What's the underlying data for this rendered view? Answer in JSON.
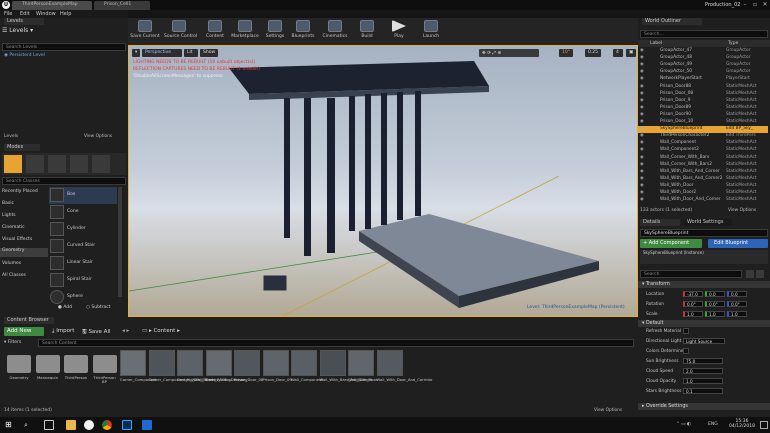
{
  "window": {
    "tabs": [
      "ThirdPersonExampleMap",
      "Prison_Cell1"
    ],
    "project_name": "Production_02",
    "logo": "U"
  },
  "menu": [
    "File",
    "Edit",
    "Window",
    "Help"
  ],
  "levels_panel": {
    "tab": "Levels",
    "title": "Levels",
    "search_placeholder": "Search Levels",
    "item": "Persistent Level",
    "footer": "Levels",
    "view_options": "View Options"
  },
  "modes_panel": {
    "tab": "Modes",
    "search_placeholder": "Search Classes",
    "categories": [
      "Recently Placed",
      "Basic",
      "Lights",
      "Cinematic",
      "Visual Effects",
      "Geometry",
      "Volumes",
      "All Classes"
    ],
    "items": [
      "Box",
      "Cone",
      "Cylinder",
      "Curved Stair",
      "Linear Stair",
      "Spiral Stair",
      "Sphere"
    ],
    "add_label": "Add",
    "subtract_label": "Subtract"
  },
  "toolbar": {
    "buttons": [
      "Save Current",
      "Source Control",
      "Content",
      "Marketplace",
      "Settings",
      "Blueprints",
      "Cinematics",
      "Build",
      "Play",
      "Launch"
    ]
  },
  "viewport": {
    "perspective": "Perspective",
    "lit": "Lit",
    "show": "Show",
    "warning1": "LIGHTING NEEDS TO BE REBUILT (10 unbuilt object(s))",
    "warning2": "REFLECTION CAPTURES NEED TO BE REBUILT (1 unbuilt)",
    "warning3": "'DisableAllScreenMessages' to suppress",
    "level_label": "Level:  ThirdPersonExampleMap (Persistent)",
    "snap_angle": "10°",
    "snap_scale": "0.25",
    "camera_speed": "4"
  },
  "world_outliner": {
    "tab": "World Outliner",
    "search_placeholder": "Search...",
    "col_label": "Label",
    "col_type": "Type",
    "rows": [
      {
        "label": "GroupActor_47",
        "type": "GroupActor"
      },
      {
        "label": "GroupActor_48",
        "type": "GroupActor"
      },
      {
        "label": "GroupActor_49",
        "type": "GroupActor"
      },
      {
        "label": "GroupActor_50",
        "type": "GroupActor"
      },
      {
        "label": "NetworkPlayerStart",
        "type": "PlayerStart"
      },
      {
        "label": "Prison_Door88",
        "type": "StaticMeshAct"
      },
      {
        "label": "Prison_Door_08",
        "type": "StaticMeshAct"
      },
      {
        "label": "Prison_Door_9",
        "type": "StaticMeshAct"
      },
      {
        "label": "Prison_Door89",
        "type": "StaticMeshAct"
      },
      {
        "label": "Prison_Door90",
        "type": "StaticMeshAct"
      },
      {
        "label": "Prison_Door_10",
        "type": "StaticMeshAct"
      },
      {
        "label": "SkySphereBlueprint",
        "type": "Edit BP_Sky_"
      },
      {
        "label": "ThirdPersonCharacter2",
        "type": "Edit ThirdPers"
      },
      {
        "label": "Wall_Component",
        "type": "StaticMeshAct"
      },
      {
        "label": "Wall_Component2",
        "type": "StaticMeshAct"
      },
      {
        "label": "Wall_Corner_With_Bars",
        "type": "StaticMeshAct"
      },
      {
        "label": "Wall_Corner_With_Bars2",
        "type": "StaticMeshAct"
      },
      {
        "label": "Wall_With_Bars_And_Corner",
        "type": "StaticMeshAct"
      },
      {
        "label": "Wall_With_Bars_And_Corner2",
        "type": "StaticMeshAct"
      },
      {
        "label": "Wall_With_Door",
        "type": "StaticMeshAct"
      },
      {
        "label": "Wall_With_Door2",
        "type": "StaticMeshAct"
      },
      {
        "label": "Wall_With_Door_And_Corner",
        "type": "StaticMeshAct"
      }
    ],
    "selected_index": 11,
    "footer": "133 actors (1 selected)",
    "view_options": "View Options"
  },
  "details": {
    "tab": "Details",
    "tab2": "World Settings",
    "actor_name": "SkySphereBlueprint",
    "add_component": "+ Add Component",
    "edit_blueprint": "Edit Blueprint",
    "component": "SkySphereBlueprint (Instance)",
    "search_placeholder": "Search",
    "transform": {
      "title": "Transform",
      "location_label": "Location",
      "location": [
        "-37.0",
        "0.0",
        "0.0"
      ],
      "rotation_label": "Rotation",
      "rotation": [
        "0.0°",
        "0.0°",
        "0.0°"
      ],
      "scale_label": "Scale",
      "scale": [
        "1.0",
        "1.0",
        "1.0"
      ]
    },
    "default": {
      "title": "Default",
      "props": [
        {
          "label": "Refresh Material",
          "value": ""
        },
        {
          "label": "Directional Light A",
          "value": "Light Source"
        },
        {
          "label": "Colors Determined",
          "value": ""
        },
        {
          "label": "Sun Brightness",
          "value": "75.0"
        },
        {
          "label": "Cloud Speed",
          "value": "2.0"
        },
        {
          "label": "Cloud Opacity",
          "value": "1.0"
        },
        {
          "label": "Stars Brightness",
          "value": "0.1"
        }
      ]
    },
    "override": "Override Settings"
  },
  "content_browser": {
    "tab": "Content Browser",
    "add_new": "Add New",
    "import": "Import",
    "save_all": "Save All",
    "path": "Content",
    "filters": "Filters",
    "search_placeholder": "Search Content",
    "assets": [
      {
        "label": "Geometry",
        "kind": "folder"
      },
      {
        "label": "Mannequin",
        "kind": "folder"
      },
      {
        "label": "ThirdPerson",
        "kind": "folder"
      },
      {
        "label": "ThirdPerson BP",
        "kind": "folder"
      },
      {
        "label": "Corner_Component",
        "kind": "mesh"
      },
      {
        "label": "Corner_Component_No_Wall_Tiled",
        "kind": "mesh"
      },
      {
        "label": "Corner_With_Barred_Window",
        "kind": "mesh"
      },
      {
        "label": "Corner_With_Doorway",
        "kind": "mesh"
      },
      {
        "label": "Prison_Door_08",
        "kind": "mesh"
      },
      {
        "label": "Prison_Door_09",
        "kind": "mesh"
      },
      {
        "label": "Wall_Component",
        "kind": "mesh"
      },
      {
        "label": "Wall_With_Bars_And_Corner",
        "kind": "mesh"
      },
      {
        "label": "Wall_With_Door",
        "kind": "mesh"
      },
      {
        "label": "Wall_With_Door_And_Corridor",
        "kind": "mesh"
      }
    ],
    "footer": "14 items (1 selected)",
    "view_options": "View Options"
  },
  "taskbar": {
    "lang": "ENG",
    "time": "15:36",
    "date": "04/12/2018"
  }
}
